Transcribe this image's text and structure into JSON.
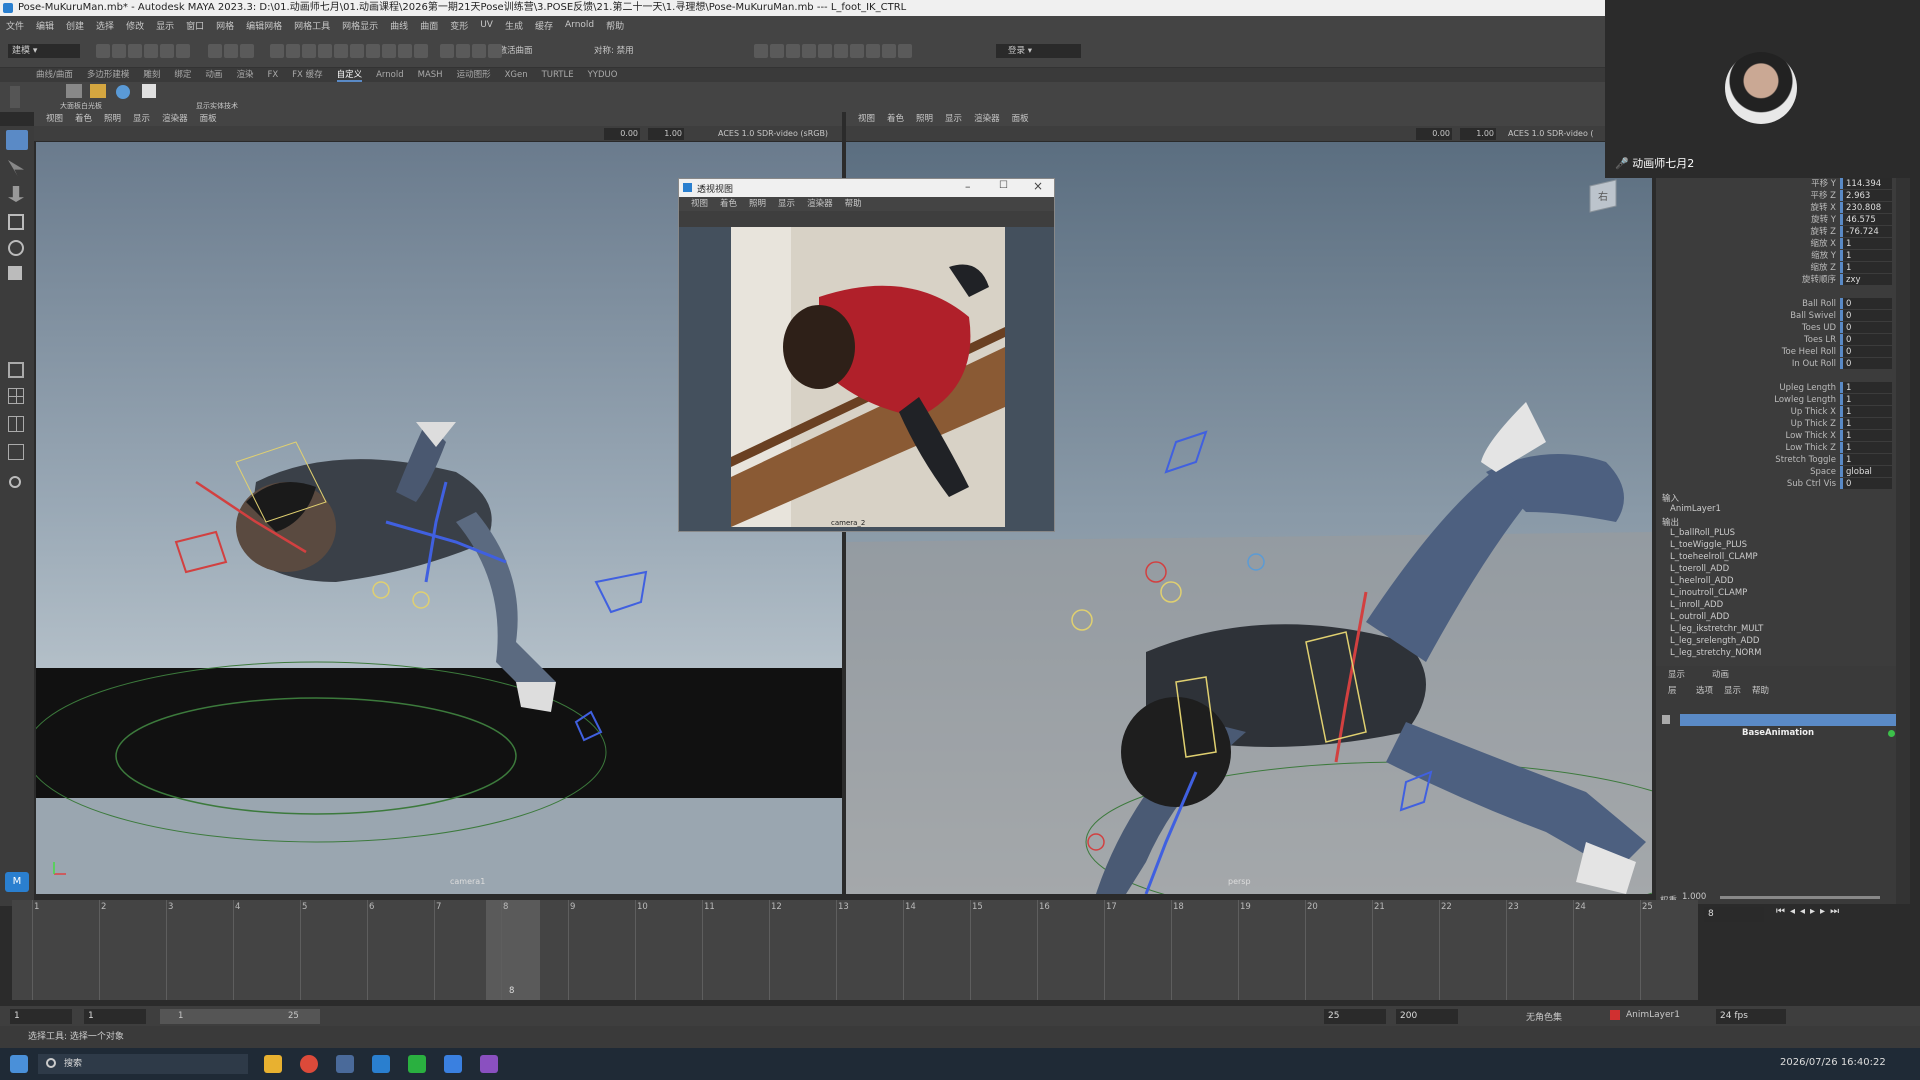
{
  "window": {
    "title": "Pose-MuKuruMan.mb* - Autodesk MAYA 2023.3: D:\\01.动画师七月\\01.动画课程\\2026第一期21天Pose训练营\\3.POSE反馈\\21.第二十一天\\1.寻理想\\Pose-MuKuruMan.mb   ---   L_foot_IK_CTRL"
  },
  "menu": [
    "文件",
    "编辑",
    "创建",
    "选择",
    "修改",
    "显示",
    "窗口",
    "网格",
    "编辑网格",
    "网格工具",
    "网格显示",
    "曲线",
    "曲面",
    "变形",
    "UV",
    "生成",
    "缓存",
    "Arnold",
    "帮助"
  ],
  "toolbar": {
    "mode": "建模",
    "surface": "无激活曲面",
    "symmetry": "对称: 禁用",
    "login": "登录"
  },
  "shelf_tabs": [
    "曲线/曲面",
    "多边形建模",
    "雕刻",
    "绑定",
    "动画",
    "渲染",
    "FX",
    "FX 缓存",
    "自定义",
    "Arnold",
    "MASH",
    "运动图形",
    "XGen",
    "TURTLE",
    "YYDUO"
  ],
  "shelf_active": "自定义",
  "shelf_items": [
    "大面板白光板",
    "显示实体技术"
  ],
  "left_viewport": {
    "menu": [
      "视图",
      "着色",
      "照明",
      "显示",
      "渲染器",
      "面板"
    ],
    "field1": "0.00",
    "field2": "1.00",
    "colorspace": "ACES 1.0 SDR-video (sRGB)",
    "camera": "camera1"
  },
  "right_viewport": {
    "menu": [
      "视图",
      "着色",
      "照明",
      "显示",
      "渲染器",
      "面板"
    ],
    "field1": "0.00",
    "field2": "1.00",
    "colorspace": "ACES 1.0 SDR-video (",
    "camera": "persp",
    "viewcube": "右"
  },
  "float_window": {
    "title": "透视视图",
    "menu": [
      "视图",
      "着色",
      "照明",
      "显示",
      "渲染器",
      "帮助"
    ],
    "camera": "camera_2"
  },
  "streamer": {
    "name": "动画师七月2"
  },
  "channels": [
    {
      "label": "平移 Y",
      "value": "114.394"
    },
    {
      "label": "平移 Z",
      "value": "2.963"
    },
    {
      "label": "旋转 X",
      "value": "230.808"
    },
    {
      "label": "旋转 Y",
      "value": "46.575"
    },
    {
      "label": "旋转 Z",
      "value": "-76.724"
    },
    {
      "label": "缩放 X",
      "value": "1"
    },
    {
      "label": "缩放 Y",
      "value": "1"
    },
    {
      "label": "缩放 Z",
      "value": "1"
    },
    {
      "label": "旋转顺序",
      "value": "zxy"
    },
    {
      "label": "Ball Roll",
      "value": "0"
    },
    {
      "label": "Ball Swivel",
      "value": "0"
    },
    {
      "label": "Toes UD",
      "value": "0"
    },
    {
      "label": "Toes LR",
      "value": "0"
    },
    {
      "label": "Toe Heel Roll",
      "value": "0"
    },
    {
      "label": "In Out Roll",
      "value": "0"
    },
    {
      "label": "Upleg Length",
      "value": "1"
    },
    {
      "label": "Lowleg Length",
      "value": "1"
    },
    {
      "label": "Up Thick X",
      "value": "1"
    },
    {
      "label": "Up Thick Z",
      "value": "1"
    },
    {
      "label": "Low Thick X",
      "value": "1"
    },
    {
      "label": "Low Thick Z",
      "value": "1"
    },
    {
      "label": "Stretch Toggle",
      "value": "1"
    },
    {
      "label": "Space",
      "value": "global"
    },
    {
      "label": "Sub Ctrl Vis",
      "value": "0"
    }
  ],
  "inputs": {
    "input_label": "输入",
    "input_node": "AnimLayer1",
    "output_label": "输出",
    "output_nodes": [
      "L_ballRoll_PLUS",
      "L_toeWiggle_PLUS",
      "L_toeheelroll_CLAMP",
      "L_toeroll_ADD",
      "L_heelroll_ADD",
      "L_inoutroll_CLAMP",
      "L_inroll_ADD",
      "L_outroll_ADD",
      "L_leg_ikstretchr_MULT",
      "L_leg_srelength_ADD",
      "L_leg_stretchy_NORM"
    ]
  },
  "layer_editor": {
    "tabs": [
      "显示",
      "动画"
    ],
    "menu": [
      "层",
      "选项",
      "显示",
      "帮助"
    ],
    "base_layer": "BaseAnimation",
    "weight_label": "权重",
    "weight_value": "1.000"
  },
  "timeline": {
    "ticks": [
      "1",
      "2",
      "3",
      "4",
      "5",
      "6",
      "7",
      "8",
      "9",
      "10",
      "11",
      "12",
      "13",
      "14",
      "15",
      "16",
      "17",
      "18",
      "19",
      "20",
      "21",
      "22",
      "23",
      "24",
      "25"
    ],
    "current": "8",
    "current_frame_field": "8"
  },
  "range": {
    "start": "1",
    "inner_start": "1",
    "slider_start": "1",
    "slider_end": "25",
    "end": "25",
    "outer_end": "200",
    "character_set": "无角色集",
    "anim_layer": "AnimLayer1",
    "fps": "24 fps"
  },
  "helpline": {
    "text": "选择工具: 选择一个对象"
  },
  "taskbar": {
    "search": "搜索",
    "clock": "2026/07/26 16:40:22"
  }
}
